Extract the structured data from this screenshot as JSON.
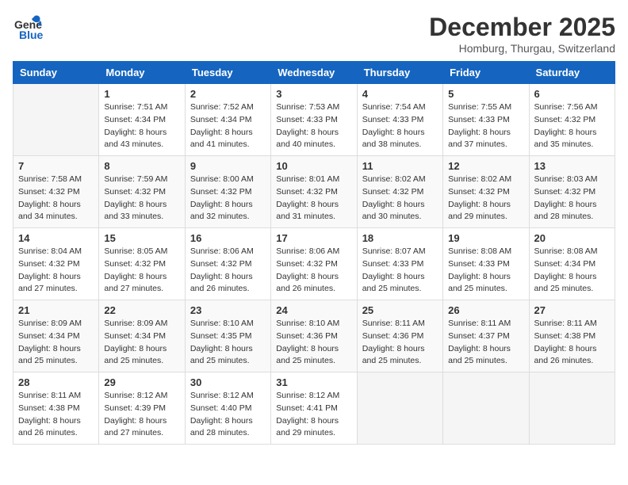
{
  "header": {
    "logo_line1": "General",
    "logo_line2": "Blue",
    "month": "December 2025",
    "location": "Homburg, Thurgau, Switzerland"
  },
  "weekdays": [
    "Sunday",
    "Monday",
    "Tuesday",
    "Wednesday",
    "Thursday",
    "Friday",
    "Saturday"
  ],
  "weeks": [
    [
      {
        "day": "",
        "sunrise": "",
        "sunset": "",
        "daylight": ""
      },
      {
        "day": "1",
        "sunrise": "Sunrise: 7:51 AM",
        "sunset": "Sunset: 4:34 PM",
        "daylight": "Daylight: 8 hours and 43 minutes."
      },
      {
        "day": "2",
        "sunrise": "Sunrise: 7:52 AM",
        "sunset": "Sunset: 4:34 PM",
        "daylight": "Daylight: 8 hours and 41 minutes."
      },
      {
        "day": "3",
        "sunrise": "Sunrise: 7:53 AM",
        "sunset": "Sunset: 4:33 PM",
        "daylight": "Daylight: 8 hours and 40 minutes."
      },
      {
        "day": "4",
        "sunrise": "Sunrise: 7:54 AM",
        "sunset": "Sunset: 4:33 PM",
        "daylight": "Daylight: 8 hours and 38 minutes."
      },
      {
        "day": "5",
        "sunrise": "Sunrise: 7:55 AM",
        "sunset": "Sunset: 4:33 PM",
        "daylight": "Daylight: 8 hours and 37 minutes."
      },
      {
        "day": "6",
        "sunrise": "Sunrise: 7:56 AM",
        "sunset": "Sunset: 4:32 PM",
        "daylight": "Daylight: 8 hours and 35 minutes."
      }
    ],
    [
      {
        "day": "7",
        "sunrise": "Sunrise: 7:58 AM",
        "sunset": "Sunset: 4:32 PM",
        "daylight": "Daylight: 8 hours and 34 minutes."
      },
      {
        "day": "8",
        "sunrise": "Sunrise: 7:59 AM",
        "sunset": "Sunset: 4:32 PM",
        "daylight": "Daylight: 8 hours and 33 minutes."
      },
      {
        "day": "9",
        "sunrise": "Sunrise: 8:00 AM",
        "sunset": "Sunset: 4:32 PM",
        "daylight": "Daylight: 8 hours and 32 minutes."
      },
      {
        "day": "10",
        "sunrise": "Sunrise: 8:01 AM",
        "sunset": "Sunset: 4:32 PM",
        "daylight": "Daylight: 8 hours and 31 minutes."
      },
      {
        "day": "11",
        "sunrise": "Sunrise: 8:02 AM",
        "sunset": "Sunset: 4:32 PM",
        "daylight": "Daylight: 8 hours and 30 minutes."
      },
      {
        "day": "12",
        "sunrise": "Sunrise: 8:02 AM",
        "sunset": "Sunset: 4:32 PM",
        "daylight": "Daylight: 8 hours and 29 minutes."
      },
      {
        "day": "13",
        "sunrise": "Sunrise: 8:03 AM",
        "sunset": "Sunset: 4:32 PM",
        "daylight": "Daylight: 8 hours and 28 minutes."
      }
    ],
    [
      {
        "day": "14",
        "sunrise": "Sunrise: 8:04 AM",
        "sunset": "Sunset: 4:32 PM",
        "daylight": "Daylight: 8 hours and 27 minutes."
      },
      {
        "day": "15",
        "sunrise": "Sunrise: 8:05 AM",
        "sunset": "Sunset: 4:32 PM",
        "daylight": "Daylight: 8 hours and 27 minutes."
      },
      {
        "day": "16",
        "sunrise": "Sunrise: 8:06 AM",
        "sunset": "Sunset: 4:32 PM",
        "daylight": "Daylight: 8 hours and 26 minutes."
      },
      {
        "day": "17",
        "sunrise": "Sunrise: 8:06 AM",
        "sunset": "Sunset: 4:32 PM",
        "daylight": "Daylight: 8 hours and 26 minutes."
      },
      {
        "day": "18",
        "sunrise": "Sunrise: 8:07 AM",
        "sunset": "Sunset: 4:33 PM",
        "daylight": "Daylight: 8 hours and 25 minutes."
      },
      {
        "day": "19",
        "sunrise": "Sunrise: 8:08 AM",
        "sunset": "Sunset: 4:33 PM",
        "daylight": "Daylight: 8 hours and 25 minutes."
      },
      {
        "day": "20",
        "sunrise": "Sunrise: 8:08 AM",
        "sunset": "Sunset: 4:34 PM",
        "daylight": "Daylight: 8 hours and 25 minutes."
      }
    ],
    [
      {
        "day": "21",
        "sunrise": "Sunrise: 8:09 AM",
        "sunset": "Sunset: 4:34 PM",
        "daylight": "Daylight: 8 hours and 25 minutes."
      },
      {
        "day": "22",
        "sunrise": "Sunrise: 8:09 AM",
        "sunset": "Sunset: 4:34 PM",
        "daylight": "Daylight: 8 hours and 25 minutes."
      },
      {
        "day": "23",
        "sunrise": "Sunrise: 8:10 AM",
        "sunset": "Sunset: 4:35 PM",
        "daylight": "Daylight: 8 hours and 25 minutes."
      },
      {
        "day": "24",
        "sunrise": "Sunrise: 8:10 AM",
        "sunset": "Sunset: 4:36 PM",
        "daylight": "Daylight: 8 hours and 25 minutes."
      },
      {
        "day": "25",
        "sunrise": "Sunrise: 8:11 AM",
        "sunset": "Sunset: 4:36 PM",
        "daylight": "Daylight: 8 hours and 25 minutes."
      },
      {
        "day": "26",
        "sunrise": "Sunrise: 8:11 AM",
        "sunset": "Sunset: 4:37 PM",
        "daylight": "Daylight: 8 hours and 25 minutes."
      },
      {
        "day": "27",
        "sunrise": "Sunrise: 8:11 AM",
        "sunset": "Sunset: 4:38 PM",
        "daylight": "Daylight: 8 hours and 26 minutes."
      }
    ],
    [
      {
        "day": "28",
        "sunrise": "Sunrise: 8:11 AM",
        "sunset": "Sunset: 4:38 PM",
        "daylight": "Daylight: 8 hours and 26 minutes."
      },
      {
        "day": "29",
        "sunrise": "Sunrise: 8:12 AM",
        "sunset": "Sunset: 4:39 PM",
        "daylight": "Daylight: 8 hours and 27 minutes."
      },
      {
        "day": "30",
        "sunrise": "Sunrise: 8:12 AM",
        "sunset": "Sunset: 4:40 PM",
        "daylight": "Daylight: 8 hours and 28 minutes."
      },
      {
        "day": "31",
        "sunrise": "Sunrise: 8:12 AM",
        "sunset": "Sunset: 4:41 PM",
        "daylight": "Daylight: 8 hours and 29 minutes."
      },
      {
        "day": "",
        "sunrise": "",
        "sunset": "",
        "daylight": ""
      },
      {
        "day": "",
        "sunrise": "",
        "sunset": "",
        "daylight": ""
      },
      {
        "day": "",
        "sunrise": "",
        "sunset": "",
        "daylight": ""
      }
    ]
  ]
}
